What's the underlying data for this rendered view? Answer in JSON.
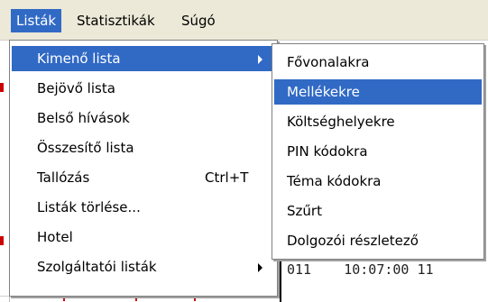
{
  "menubar": {
    "items": [
      {
        "label": "Listák",
        "active": true
      },
      {
        "label": "Statisztikák",
        "active": false
      },
      {
        "label": "Súgó",
        "active": false
      }
    ]
  },
  "menu": {
    "items": [
      {
        "label": "Kimenő lista",
        "submenu": true,
        "highlight": true
      },
      {
        "label": "Bejövő lista"
      },
      {
        "label": "Belső hívások"
      },
      {
        "label": "Összesítő lista"
      },
      {
        "label": "Tallózás",
        "shortcut": "Ctrl+T"
      },
      {
        "label": "Listák törlése..."
      },
      {
        "label": "Hotel"
      },
      {
        "label": "Szolgáltatói listák",
        "submenu": true
      }
    ]
  },
  "submenu": {
    "items": [
      {
        "label": "Fővonalakra"
      },
      {
        "label": "Mellékekre",
        "highlight": true
      },
      {
        "label": "Költséghelyekre"
      },
      {
        "label": "PIN kódokra"
      },
      {
        "label": "Téma kódokra"
      },
      {
        "label": "Szűrt"
      },
      {
        "label": "Dolgozói részletező"
      }
    ]
  },
  "background": {
    "visible_text": "011    10:07:00 11"
  },
  "colors": {
    "highlight": "#316ac5",
    "menubar_bg": "#ece9d8",
    "accent_red": "#cc0000"
  }
}
